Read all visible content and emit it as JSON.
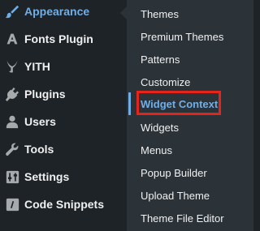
{
  "sidebar": {
    "items": [
      {
        "label": "Appearance",
        "icon": "paintbrush-icon",
        "active": true
      },
      {
        "label": "Fonts Plugin",
        "icon": "font-a-icon"
      },
      {
        "label": "YITH",
        "icon": "yith-y-icon"
      },
      {
        "label": "Plugins",
        "icon": "plug-icon"
      },
      {
        "label": "Users",
        "icon": "user-icon"
      },
      {
        "label": "Tools",
        "icon": "wrench-icon"
      },
      {
        "label": "Settings",
        "icon": "sliders-icon"
      },
      {
        "label": "Code Snippets",
        "icon": "code-icon"
      }
    ]
  },
  "submenu": {
    "items": [
      {
        "label": "Themes"
      },
      {
        "label": "Premium Themes"
      },
      {
        "label": "Patterns"
      },
      {
        "label": "Customize"
      },
      {
        "label": "Widget Context",
        "current": true
      },
      {
        "label": "Widgets"
      },
      {
        "label": "Menus"
      },
      {
        "label": "Popup Builder"
      },
      {
        "label": "Upload Theme"
      },
      {
        "label": "Theme File Editor"
      }
    ]
  },
  "colors": {
    "sidebar_bg": "#1d2327",
    "submenu_bg": "#2c3338",
    "text": "#f0f0f1",
    "accent": "#72aee6",
    "icon": "#a7aaad",
    "highlight": "#e5241b"
  }
}
